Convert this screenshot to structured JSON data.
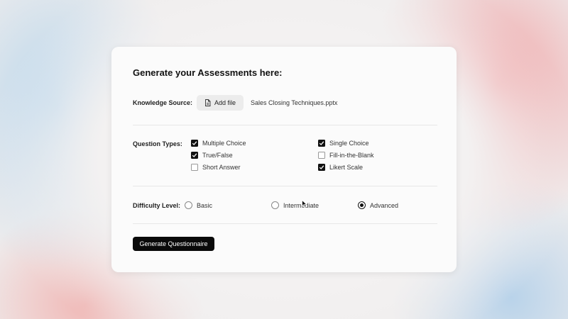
{
  "form": {
    "title": "Generate your Assessments here:",
    "knowledge_source": {
      "label": "Knowledge Source:",
      "add_file_label": "Add file",
      "file_name": "Sales Closing Techniques.pptx"
    },
    "question_types": {
      "label": "Question Types:",
      "options": [
        {
          "label": "Multiple Choice",
          "checked": true
        },
        {
          "label": "Single Choice",
          "checked": true
        },
        {
          "label": "True/False",
          "checked": true
        },
        {
          "label": "Fill-in-the-Blank",
          "checked": false
        },
        {
          "label": "Short Answer",
          "checked": false
        },
        {
          "label": "Likert Scale",
          "checked": true
        }
      ]
    },
    "difficulty": {
      "label": "Difficulty Level:",
      "options": [
        {
          "label": "Basic",
          "selected": false
        },
        {
          "label": "Intermediate",
          "selected": false
        },
        {
          "label": "Advanced",
          "selected": true
        }
      ]
    },
    "generate_label": "Generate Questionnaire"
  }
}
